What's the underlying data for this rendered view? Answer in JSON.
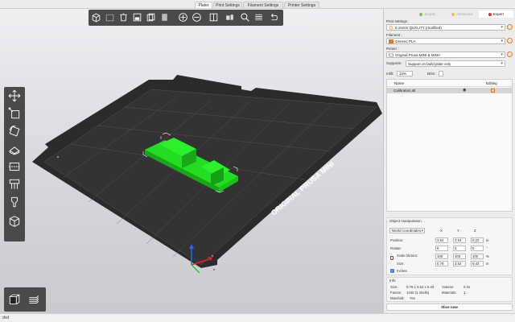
{
  "tabs": [
    "Plater",
    "Print Settings",
    "Filament Settings",
    "Printer Settings"
  ],
  "modes": [
    {
      "label": "Simple",
      "color": "#7dc142"
    },
    {
      "label": "Advanced",
      "color": "#f0c040"
    },
    {
      "label": "Expert",
      "color": "#e03030"
    }
  ],
  "print_settings": {
    "label": "Print settings :",
    "value": "0.15mm QUALITY (modified)"
  },
  "filament": {
    "label": "Filament :",
    "value": "Generic PLA",
    "color": "#e07b20"
  },
  "printer": {
    "label": "Printer :",
    "value": "Original Prusa MINI & MINI+"
  },
  "supports": {
    "label": "Supports:",
    "value": "Support on build plate only"
  },
  "infill": {
    "label": "Infill:",
    "value": "15%"
  },
  "brim": {
    "label": "Brim:"
  },
  "objects": {
    "col_name": "Name",
    "col_editing": "Editing",
    "rows": [
      {
        "name": "Calibration.stl"
      }
    ]
  },
  "manipulation": {
    "title": "Object manipulation",
    "coord_system": "World coordinates",
    "axes": [
      "X",
      "Y",
      "Z"
    ],
    "position": {
      "label": "Position:",
      "values": [
        "3.54",
        "3.54",
        "0.22"
      ],
      "unit": "in"
    },
    "rotate": {
      "label": "Rotate:",
      "values": [
        "0",
        "0",
        "0"
      ],
      "unit": "°"
    },
    "scale": {
      "label": "Scale factors:",
      "values": [
        "100",
        "100",
        "100"
      ],
      "unit": "%"
    },
    "size": {
      "label": "Size:",
      "values": [
        "0.79",
        "3.52",
        "0.43"
      ],
      "unit": "in"
    },
    "inches_label": "Inches"
  },
  "info": {
    "title": "Info",
    "size_label": "Size:",
    "size_value": "0.79 x 3.52 x 0.43",
    "volume_label": "Volume:",
    "volume_value": "0.31",
    "facets_label": "Facets:",
    "facets_value": "1440 (1 shells)",
    "materials_label": "Materials:",
    "materials_value": "1",
    "manifold_label": "Manifold:",
    "manifold_value": "Yes"
  },
  "slice_button": "Slice now",
  "status_text": "dvd",
  "bed_label": "ORIGINAL PRUSA MINI",
  "colors": {
    "accent": "#e07b20",
    "model": "#22dd22",
    "bed": "#2a2a2a",
    "toolbar": "#4a4a4a"
  }
}
